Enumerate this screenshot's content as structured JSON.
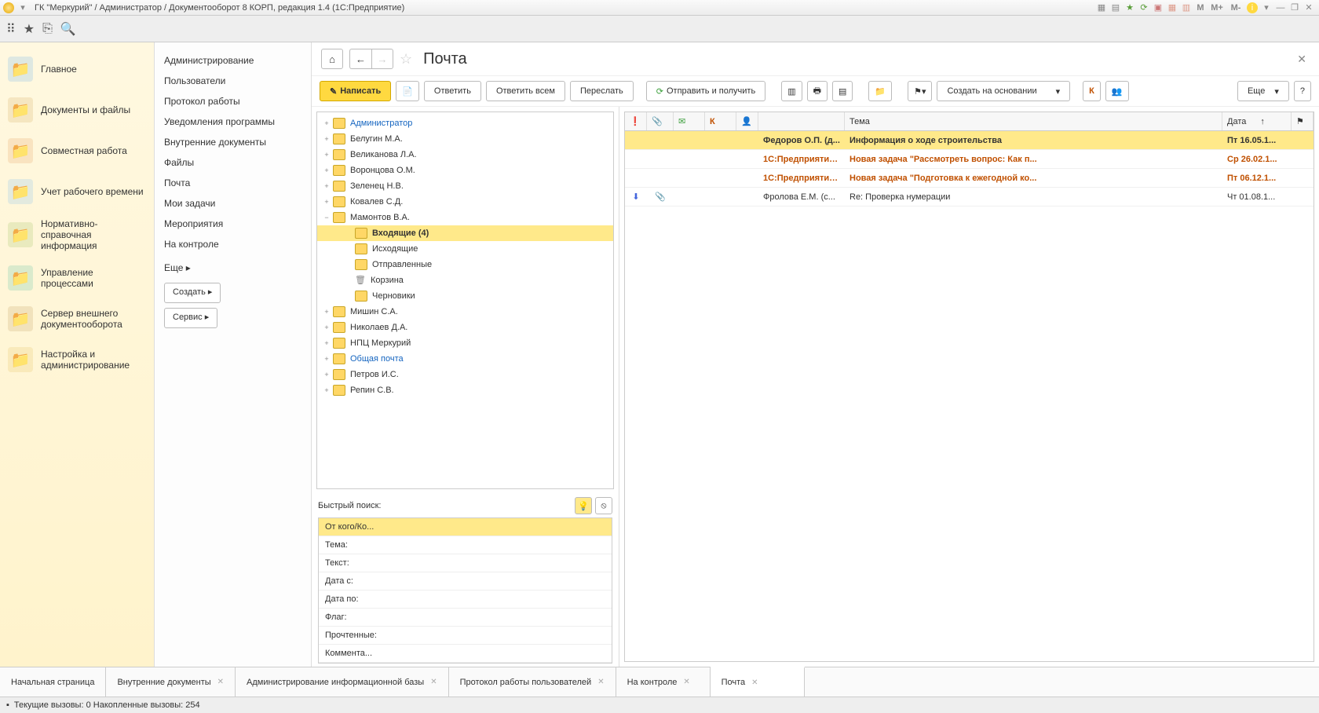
{
  "titlebar": {
    "title": "ГК \"Меркурий\" / Администратор / Документооборот 8 КОРП, редакция 1.4  (1С:Предприятие)",
    "mbuttons": [
      "M",
      "M+",
      "M-"
    ]
  },
  "leftnav": [
    {
      "label": "Главное",
      "color": "#7ab8e8"
    },
    {
      "label": "Документы и файлы",
      "color": "#d9b36a"
    },
    {
      "label": "Совместная работа",
      "color": "#e8a86a"
    },
    {
      "label": "Учет рабочего времени",
      "color": "#8fc4ec"
    },
    {
      "label": "Нормативно-справочная информация",
      "color": "#a8c86a"
    },
    {
      "label": "Управление процессами",
      "color": "#6ac8a8"
    },
    {
      "label": "Сервер внешнего документооборота",
      "color": "#c8a86a"
    },
    {
      "label": "Настройка и администрирование",
      "color": "#e8c86a"
    }
  ],
  "secondnav": {
    "items": [
      "Администрирование",
      "Пользователи",
      "Протокол работы",
      "Уведомления программы",
      "Внутренние документы",
      "Файлы",
      "Почта",
      "Мои задачи",
      "Мероприятия",
      "На контроле"
    ],
    "more": "Еще ▸",
    "buttons": [
      "Создать ▸",
      "Сервис ▸"
    ]
  },
  "page": {
    "title": "Почта"
  },
  "mailbar": {
    "write": "Написать",
    "reply": "Ответить",
    "reply_all": "Ответить всем",
    "forward": "Переслать",
    "send_recv": "Отправить и получить",
    "create_based": "Создать на основании",
    "k": "К",
    "more": "Еще"
  },
  "folders": [
    {
      "label": "Администратор",
      "indent": 0,
      "exp": "+",
      "link": true
    },
    {
      "label": "Белугин М.А.",
      "indent": 0,
      "exp": "+"
    },
    {
      "label": "Великанова Л.А.",
      "indent": 0,
      "exp": "+"
    },
    {
      "label": "Воронцова О.М.",
      "indent": 0,
      "exp": "+"
    },
    {
      "label": "Зеленец Н.В.",
      "indent": 0,
      "exp": "+"
    },
    {
      "label": "Ковалев С.Д.",
      "indent": 0,
      "exp": "+"
    },
    {
      "label": "Мамонтов В.А.",
      "indent": 0,
      "exp": "−"
    },
    {
      "label": "Входящие (4)",
      "indent": 1,
      "sel": true
    },
    {
      "label": "Исходящие",
      "indent": 1
    },
    {
      "label": "Отправленные",
      "indent": 1
    },
    {
      "label": "Корзина",
      "indent": 1,
      "trash": true
    },
    {
      "label": "Черновики",
      "indent": 1
    },
    {
      "label": "Мишин С.А.",
      "indent": 0,
      "exp": "+"
    },
    {
      "label": "Николаев Д.А.",
      "indent": 0,
      "exp": "+"
    },
    {
      "label": "НПЦ Меркурий",
      "indent": 0,
      "exp": "+"
    },
    {
      "label": "Общая почта",
      "indent": 0,
      "exp": "+",
      "link": true
    },
    {
      "label": "Петров И.С.",
      "indent": 0,
      "exp": "+"
    },
    {
      "label": "Репин С.В.",
      "indent": 0,
      "exp": "+"
    }
  ],
  "quicksearch": {
    "label": "Быстрый поиск:",
    "rows": [
      "От кого/Ко...",
      "Тема:",
      "Текст:",
      "Дата с:",
      "Дата по:",
      "Флаг:",
      "Прочтенные:",
      "Коммента..."
    ]
  },
  "msg_headers": {
    "from_icon": "👤",
    "subject": "Тема",
    "date": "Дата",
    "k": "К"
  },
  "messages": [
    {
      "from": "Федоров О.П. (д...",
      "subject": "Информация о ходе строительства",
      "date": "Пт 16.05.1...",
      "sel": true
    },
    {
      "from": "1С:Предприятие ...",
      "subject": "Новая задача \"Рассмотреть вопрос: Как п...",
      "date": "Ср 26.02.1...",
      "special": true
    },
    {
      "from": "1С:Предприятие ...",
      "subject": "Новая задача \"Подготовка к ежегодной ко...",
      "date": "Пт 06.12.1...",
      "special": true
    },
    {
      "from": "Фролова Е.М. (с...",
      "subject": "Re: Проверка нумерации",
      "date": "Чт 01.08.1...",
      "flag": "⬇",
      "att": "📎"
    }
  ],
  "bottom_tabs": [
    {
      "label": "Начальная страница",
      "closable": false
    },
    {
      "label": "Внутренние документы",
      "closable": true
    },
    {
      "label": "Администрирование информационной базы",
      "closable": true
    },
    {
      "label": "Протокол работы пользователей",
      "closable": true
    },
    {
      "label": "На контроле",
      "closable": true
    },
    {
      "label": "Почта",
      "closable": true,
      "active": true
    }
  ],
  "statusbar": {
    "text": "Текущие вызовы: 0  Накопленные вызовы: 254"
  }
}
